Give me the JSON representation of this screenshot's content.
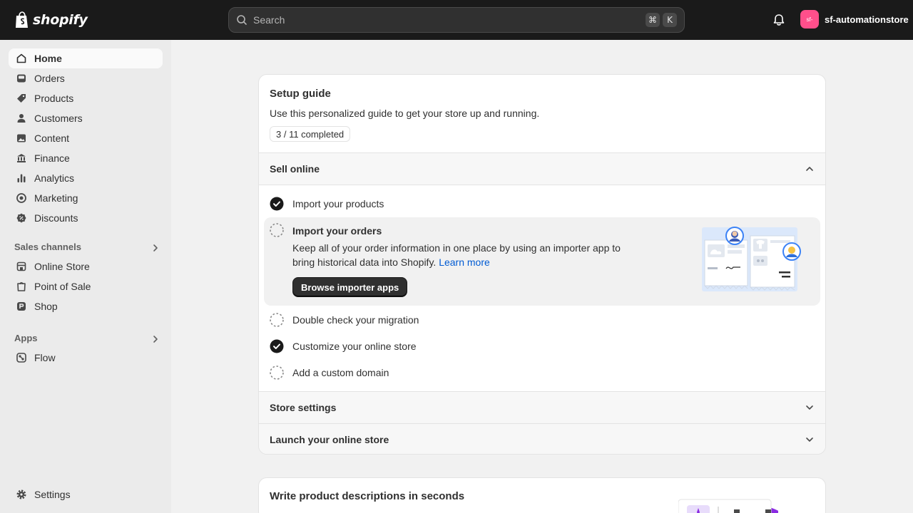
{
  "topbar": {
    "brand": "shopify",
    "search_placeholder": "Search",
    "shortcut_keys": [
      "⌘",
      "K"
    ],
    "store_avatar_text": "sf-",
    "store_name": "sf-automationstore"
  },
  "sidebar": {
    "items": [
      {
        "label": "Home",
        "icon": "home-icon",
        "active": true
      },
      {
        "label": "Orders",
        "icon": "inbox-icon"
      },
      {
        "label": "Products",
        "icon": "tag-icon"
      },
      {
        "label": "Customers",
        "icon": "person-icon"
      },
      {
        "label": "Content",
        "icon": "image-icon"
      },
      {
        "label": "Finance",
        "icon": "bank-icon"
      },
      {
        "label": "Analytics",
        "icon": "bar-chart-icon"
      },
      {
        "label": "Marketing",
        "icon": "target-icon"
      },
      {
        "label": "Discounts",
        "icon": "discount-icon"
      }
    ],
    "sales_channels_title": "Sales channels",
    "sales_channels": [
      {
        "label": "Online Store",
        "icon": "storefront-icon"
      },
      {
        "label": "Point of Sale",
        "icon": "pos-icon"
      },
      {
        "label": "Shop",
        "icon": "shop-icon"
      }
    ],
    "apps_title": "Apps",
    "apps": [
      {
        "label": "Flow",
        "icon": "flow-icon"
      }
    ],
    "settings_label": "Settings"
  },
  "setup_guide": {
    "title": "Setup guide",
    "subtitle": "Use this personalized guide to get your store up and running.",
    "progress_text": "3 / 11 completed",
    "progress": {
      "done": 3,
      "total": 11
    },
    "sections": [
      {
        "title": "Sell online",
        "expanded": true
      },
      {
        "title": "Store settings",
        "expanded": false
      },
      {
        "title": "Launch your online store",
        "expanded": false
      }
    ],
    "tasks": [
      {
        "label": "Import your products",
        "done": true
      },
      {
        "label": "Import your orders",
        "done": false
      },
      {
        "label": "Double check your migration",
        "done": false
      },
      {
        "label": "Customize your online store",
        "done": true
      },
      {
        "label": "Add a custom domain",
        "done": false
      }
    ],
    "expanded_task": {
      "title": "Import your orders",
      "description": "Keep all of your order information in one place by using an importer app to bring historical data into Shopify.",
      "link": "Learn more",
      "button": "Browse importer apps"
    }
  },
  "second_card": {
    "title": "Write product descriptions in seconds"
  }
}
